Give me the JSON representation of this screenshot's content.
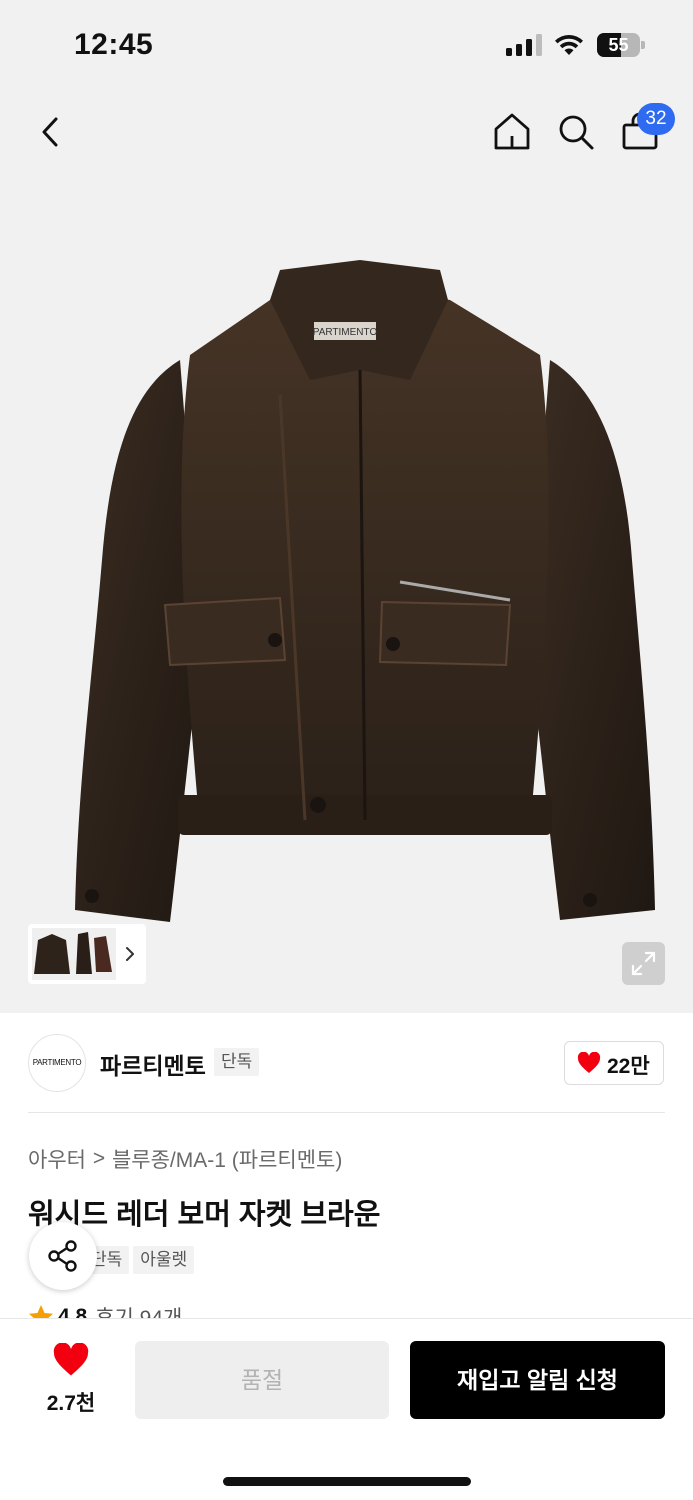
{
  "status_bar": {
    "time": "12:45",
    "battery": "55",
    "battery_level": 0.55
  },
  "nav": {
    "cart_count": "32"
  },
  "product_image": {
    "jacket_label": "PARTIMENTO"
  },
  "brand": {
    "logo_text": "PARTIMENTO",
    "name": "파르티멘토",
    "tag": "단독",
    "likes": "22만"
  },
  "product": {
    "breadcrumb": [
      "아우터",
      "블루종/MA-1 (파르티멘토)"
    ],
    "breadcrumb_separator": ">",
    "title": "워시드 레더 보머 자켓 브라운",
    "tags": [
      "단독",
      "아울렛"
    ],
    "rating": "4.8",
    "reviews": "후기 94개"
  },
  "bottom_bar": {
    "likes": "2.7천",
    "soldout_label": "품절",
    "restock_label": "재입고 알림 신청"
  },
  "colors": {
    "accent_blue": "#2f6bf0",
    "heart_red": "#f2000f",
    "star_orange": "#f5a000",
    "primary_black": "#000000"
  }
}
